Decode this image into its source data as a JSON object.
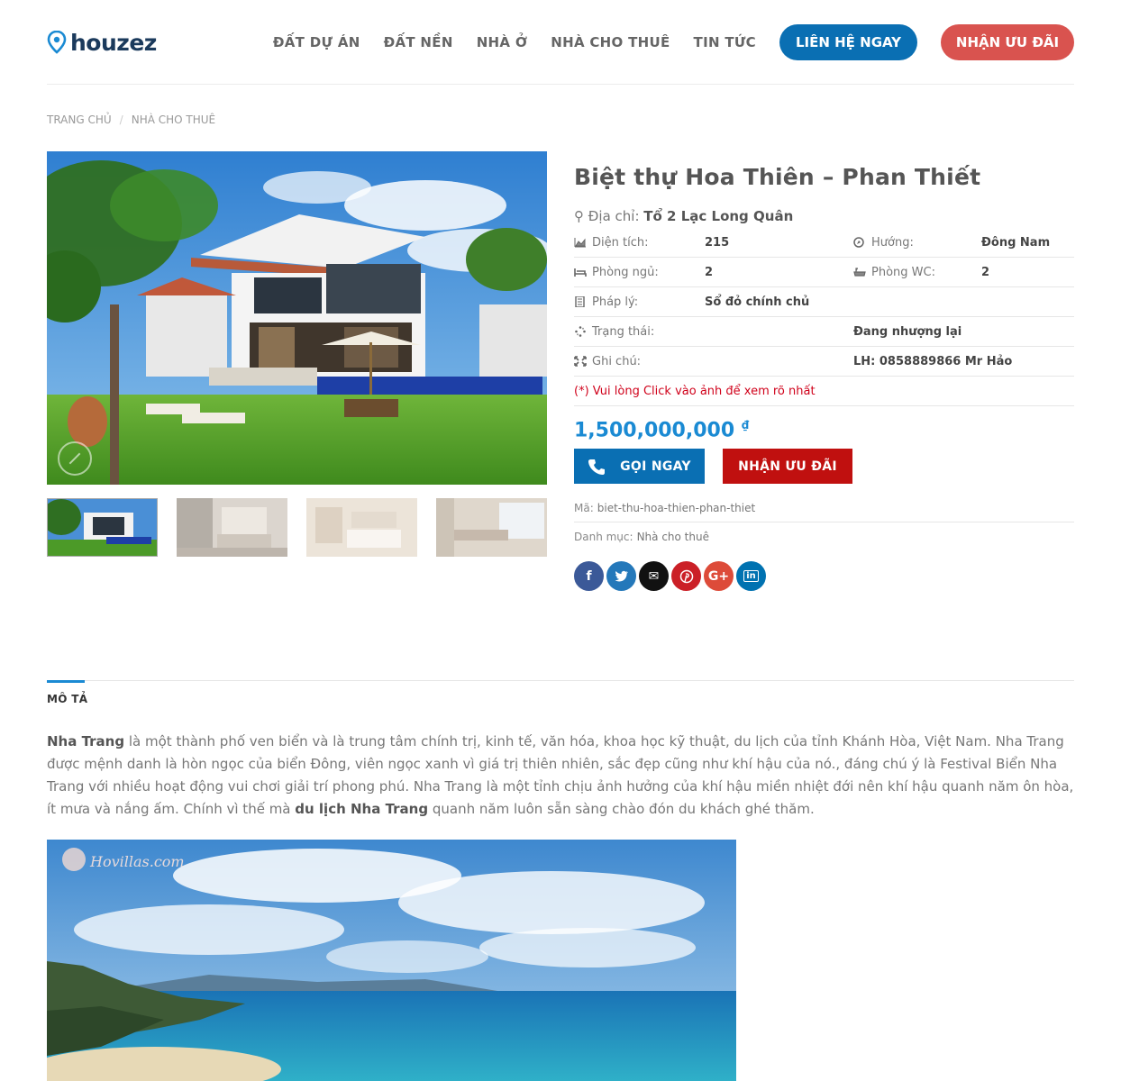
{
  "brand": {
    "name": "houzez"
  },
  "nav": {
    "links": [
      "ĐẤT DỰ ÁN",
      "ĐẤT NỀN",
      "NHÀ Ở",
      "NHÀ CHO THUÊ",
      "TIN TỨC"
    ],
    "contact_button": "LIÊN HỆ NGAY",
    "offer_button": "NHẬN ƯU ĐÃI"
  },
  "breadcrumb": [
    "TRANG CHỦ",
    "NHÀ CHO THUÊ"
  ],
  "property": {
    "title": "Biệt thự Hoa Thiên – Phan Thiết",
    "address_label": "Địa chỉ:",
    "address_value": "Tổ 2 Lạc Long Quân",
    "details": [
      {
        "label": "Diện tích:",
        "value": "215",
        "label2": "Hướng:",
        "value2": "Đông Nam"
      },
      {
        "label": "Phòng ngủ:",
        "value": "2",
        "label2": "Phòng WC:",
        "value2": "2"
      },
      {
        "label": "Pháp lý:",
        "value": "Sổ đỏ chính chủ",
        "label2": "",
        "value2": ""
      },
      {
        "label": "Trạng thái:",
        "value": "",
        "label2": "",
        "value2": "Đang nhượng lại"
      },
      {
        "label": "Ghi chú:",
        "value": "",
        "label2": "",
        "value2": "LH: 0858889866 Mr Hảo"
      }
    ],
    "note": "(*) Vui lòng Click vào ảnh để xem rõ nhất",
    "price": "1,500,000,000",
    "currency": "₫",
    "call_button": "GỌI NGAY",
    "offer_button": "NHẬN ƯU ĐÃI",
    "sku_label": "Mã:",
    "sku_value": "biet-thu-hoa-thien-phan-thiet",
    "category_label": "Danh mục:",
    "category_value": "Nhà cho thuê"
  },
  "share": [
    {
      "name": "facebook",
      "glyph": "f",
      "color": "#3b5998"
    },
    {
      "name": "twitter",
      "glyph": "t",
      "color": "#2478ba"
    },
    {
      "name": "email",
      "glyph": "✉",
      "color": "#111111"
    },
    {
      "name": "pinterest",
      "glyph": "P",
      "color": "#cb2027"
    },
    {
      "name": "google-plus",
      "glyph": "G+",
      "color": "#dd4b39"
    },
    {
      "name": "linkedin",
      "glyph": "in",
      "color": "#0072b1"
    }
  ],
  "tab": {
    "label": "MÔ TẢ"
  },
  "description": {
    "bold1": "Nha Trang",
    "text1": " là một thành phố ven biển và là trung tâm chính trị, kinh tế, văn hóa, khoa học kỹ thuật, du lịch của tỉnh Khánh Hòa, Việt Nam.  Nha Trang được mệnh danh là hòn ngọc của biển Đông, viên ngọc xanh vì giá trị thiên nhiên, sắc đẹp cũng như khí hậu của nó., đáng chú ý là Festival Biển Nha Trang với nhiều hoạt động vui chơi giải trí phong phú. Nha Trang là một tỉnh chịu ảnh hưởng của khí hậu miền nhiệt đới nên khí hậu quanh năm ôn hòa, ít mưa và nắng ấm. Chính vì thế mà ",
    "bold2": "du lịch Nha Trang",
    "text2": " quanh năm luôn sẵn sàng chào đón du khách ghé thăm."
  },
  "watermark": "Hovillas.com",
  "colors": {
    "primary": "#0a6fb3",
    "accent_red": "#d9534f",
    "price": "#1a8ad3",
    "note": "#d0021b"
  }
}
